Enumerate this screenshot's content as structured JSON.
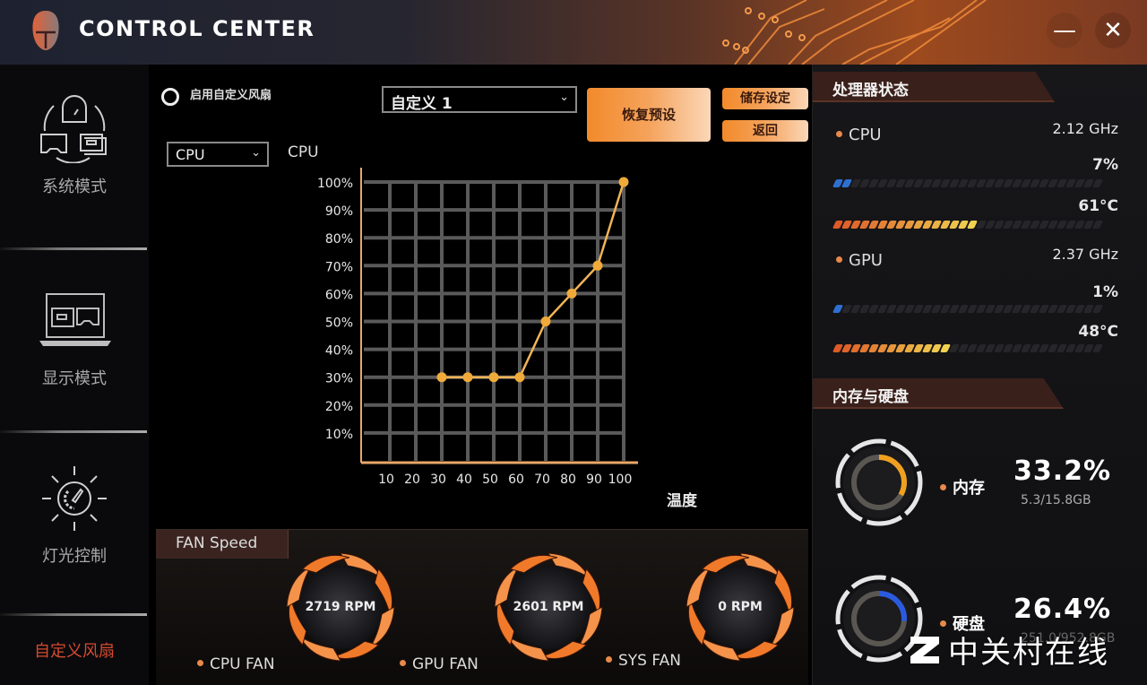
{
  "window": {
    "title": "CONTROL CENTER",
    "minimize_label": "—",
    "close_label": "✕"
  },
  "sidebar": {
    "items": [
      {
        "label": "系统模式",
        "icon": "system-mode-icon",
        "active": false
      },
      {
        "label": "显示模式",
        "icon": "display-mode-icon",
        "active": false
      },
      {
        "label": "灯光控制",
        "icon": "lighting-control-icon",
        "active": false
      },
      {
        "label": "自定义风扇",
        "icon": "",
        "active": true
      }
    ]
  },
  "fan_control": {
    "enable_custom_label": "启用自定义风扇",
    "enable_custom_checked": false,
    "profile_select": {
      "value": "自定义 1"
    },
    "source_select": {
      "value": "CPU"
    },
    "source_label": "CPU",
    "restore_button": "恢复预设",
    "save_button": "储存设定",
    "back_button": "返回"
  },
  "chart_data": {
    "type": "line",
    "title": "CPU",
    "xlabel": "温度",
    "ylabel": "",
    "x_ticks": [
      "10",
      "20",
      "30",
      "40",
      "50",
      "60",
      "70",
      "80",
      "90",
      "100"
    ],
    "y_ticks": [
      "10%",
      "20%",
      "30%",
      "40%",
      "50%",
      "60%",
      "70%",
      "80%",
      "90%",
      "100%"
    ],
    "xlim": [
      0,
      100
    ],
    "ylim": [
      0,
      100
    ],
    "grid": true,
    "series": [
      {
        "name": "CPU fan curve",
        "x": [
          30,
          40,
          50,
          60,
          70,
          80,
          90,
          100
        ],
        "y": [
          30,
          30,
          30,
          30,
          50,
          60,
          70,
          100
        ]
      }
    ],
    "colors": {
      "line": "#f0b455",
      "point": "#f0aa3a",
      "grid": "#5a5a5a",
      "axis": "#e8a76a"
    }
  },
  "fan_speed": {
    "title": "FAN Speed",
    "fans": [
      {
        "name": "CPU FAN",
        "rpm": "2719 RPM"
      },
      {
        "name": "GPU FAN",
        "rpm": "2601 RPM"
      },
      {
        "name": "SYS FAN",
        "rpm": "0 RPM"
      }
    ]
  },
  "processor_status": {
    "title": "处理器状态",
    "cpu": {
      "name": "CPU",
      "clock": "2.12 GHz",
      "usage": "7%",
      "usage_fraction": 0.07,
      "temp": "61°C",
      "temp_fraction": 0.61
    },
    "gpu": {
      "name": "GPU",
      "clock": "2.37 GHz",
      "usage": "1%",
      "usage_fraction": 0.01,
      "temp": "48°C",
      "temp_fraction": 0.48
    }
  },
  "memory_disk": {
    "title": "内存与硬盘",
    "memory": {
      "label": "内存",
      "percent": "33.2%",
      "fraction": 0.332,
      "detail": "5.3/15.8GB"
    },
    "disk": {
      "label": "硬盘",
      "percent": "26.4%",
      "fraction": 0.264,
      "detail": "251.0/952.8GB"
    }
  },
  "watermark": {
    "text": "中关村在线"
  },
  "accent": "#e8894a"
}
